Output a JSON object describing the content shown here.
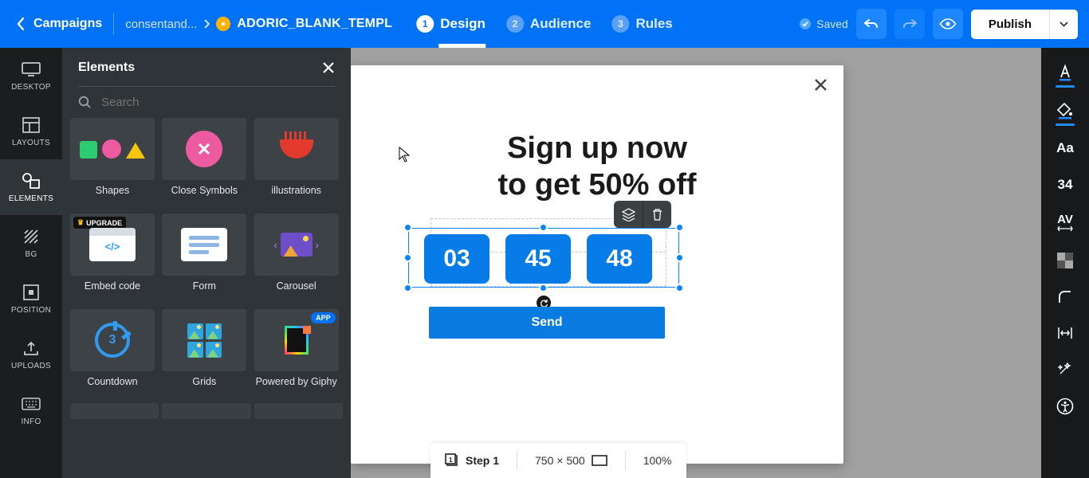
{
  "breadcrumb": {
    "root": "Campaigns",
    "parent": "consentand...",
    "current": "ADORIC_BLANK_TEMPL"
  },
  "tabs": [
    {
      "num": "1",
      "label": "Design"
    },
    {
      "num": "2",
      "label": "Audience"
    },
    {
      "num": "3",
      "label": "Rules"
    }
  ],
  "status": {
    "saved_label": "Saved"
  },
  "publish": {
    "label": "Publish"
  },
  "leftbar": [
    {
      "label": "DESKTOP"
    },
    {
      "label": "LAYOUTS"
    },
    {
      "label": "ELEMENTS"
    },
    {
      "label": "BG"
    },
    {
      "label": "POSITION"
    },
    {
      "label": "UPLOADS"
    },
    {
      "label": "INFO"
    }
  ],
  "panel": {
    "title": "Elements",
    "search_placeholder": "Search",
    "upgrade_badge": "UPGRADE",
    "app_badge": "APP",
    "items": [
      {
        "label": "Shapes"
      },
      {
        "label": "Close Symbols"
      },
      {
        "label": "illustrations"
      },
      {
        "label": "Embed code"
      },
      {
        "label": "Form"
      },
      {
        "label": "Carousel"
      },
      {
        "label": "Countdown"
      },
      {
        "label": "Grids"
      },
      {
        "label": "Powered by Giphy"
      }
    ],
    "code_icon_text": "</>",
    "countdown_num": "3"
  },
  "popup": {
    "heading_line1": "Sign up now",
    "heading_line2": "to get 50% off",
    "timer": [
      "03",
      "45",
      "48"
    ],
    "send_label": "Send"
  },
  "bottombar": {
    "step_label": "Step 1",
    "dimensions": "750 × 500",
    "zoom": "100%"
  },
  "rightbar": {
    "font_label": "Aa",
    "size_label": "34",
    "kerning_label": "AV"
  }
}
